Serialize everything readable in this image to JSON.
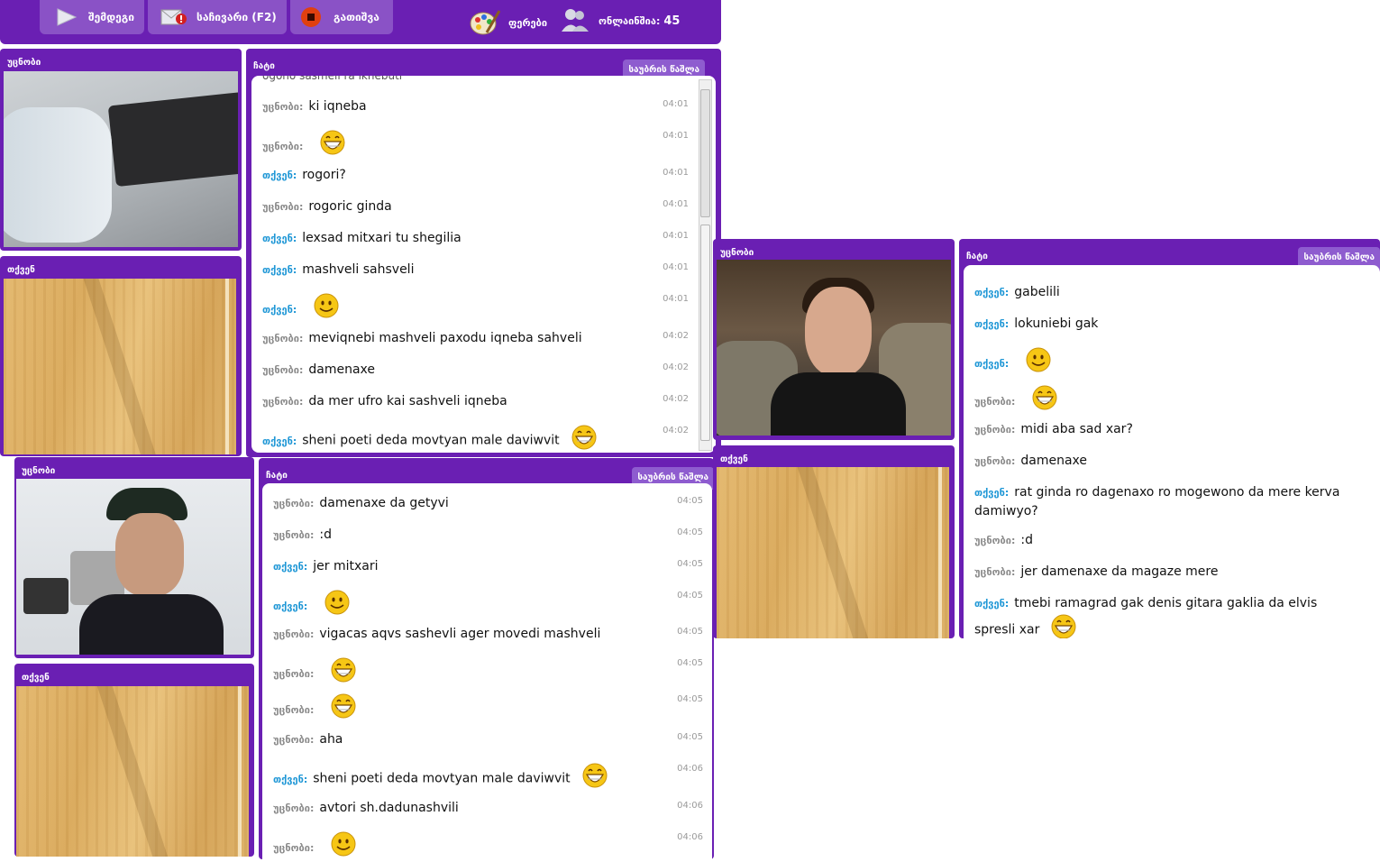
{
  "toolbar": {
    "next_label": "შემდეგი",
    "report_label": "საჩივარი (F2)",
    "stop_label": "გათიშვა",
    "colors_label": "ფერები",
    "online_label": "ონლაინშია:",
    "online_count": "45"
  },
  "labels": {
    "stranger": "უცნობი",
    "you": "თქვენ",
    "chat": "ჩატი",
    "history": "საუბრის წაშლა"
  },
  "chat1": {
    "top_partial": "ogono sasmeli ra iknebuti",
    "messages": [
      {
        "who": "უცნობი:",
        "text": "ki iqneba",
        "time": "04:01"
      },
      {
        "who": "უცნობი:",
        "text": "",
        "time": "04:01",
        "emoji": "grin"
      },
      {
        "who": "თქვენ:",
        "text": "rogori?",
        "time": "04:01"
      },
      {
        "who": "უცნობი:",
        "text": "rogoric ginda",
        "time": "04:01"
      },
      {
        "who": "თქვენ:",
        "text": "lexsad mitxari tu shegilia",
        "time": "04:01"
      },
      {
        "who": "თქვენ:",
        "text": "mashveli sahsveli",
        "time": "04:01"
      },
      {
        "who": "თქვენ:",
        "text": "",
        "time": "04:01",
        "emoji": "smile"
      },
      {
        "who": "უცნობი:",
        "text": "meviqnebi mashveli paxodu iqneba sahveli",
        "time": "04:02"
      },
      {
        "who": "უცნობი:",
        "text": "damenaxe",
        "time": "04:02"
      },
      {
        "who": "უცნობი:",
        "text": "da mer ufro kai sashveli iqneba",
        "time": "04:02"
      },
      {
        "who": "თქვენ:",
        "text": "sheni poeti deda movtyan male daviwvit",
        "time": "04:02",
        "emoji": "grin"
      }
    ]
  },
  "chat2": {
    "messages": [
      {
        "who": "უცნობი:",
        "text": "damenaxe da getyvi",
        "time": "04:05"
      },
      {
        "who": "უცნობი:",
        "text": ":d",
        "time": "04:05"
      },
      {
        "who": "თქვენ:",
        "text": "jer mitxari",
        "time": "04:05"
      },
      {
        "who": "თქვენ:",
        "text": "",
        "time": "04:05",
        "emoji": "smile"
      },
      {
        "who": "უცნობი:",
        "text": "vigacas aqvs sashevli ager movedi mashveli",
        "time": "04:05"
      },
      {
        "who": "უცნობი:",
        "text": "",
        "time": "04:05",
        "emoji": "grin"
      },
      {
        "who": "უცნობი:",
        "text": "",
        "time": "04:05",
        "emoji": "grin"
      },
      {
        "who": "უცნობი:",
        "text": "aha",
        "time": "04:05"
      },
      {
        "who": "თქვენ:",
        "text": "sheni poeti deda movtyan male daviwvit",
        "time": "04:06",
        "emoji": "grin"
      },
      {
        "who": "უცნობი:",
        "text": "avtori sh.dadunashvili",
        "time": "04:06"
      },
      {
        "who": "უცნობი:",
        "text": "",
        "time": "04:06",
        "emoji": "smile"
      }
    ]
  },
  "chat3": {
    "messages": [
      {
        "who": "თქვენ:",
        "text": "gabelili"
      },
      {
        "who": "თქვენ:",
        "text": "lokuniebi gak"
      },
      {
        "who": "თქვენ:",
        "text": "",
        "emoji": "smile"
      },
      {
        "who": "უცნობი:",
        "text": "",
        "emoji": "grin"
      },
      {
        "who": "უცნობი:",
        "text": "midi aba sad xar?"
      },
      {
        "who": "უცნობი:",
        "text": "damenaxe"
      },
      {
        "who": "თქვენ:",
        "text": "rat ginda ro dagenaxo ro mogewono da mere kerva damiwyo?"
      },
      {
        "who": "უცნობი:",
        "text": ":d"
      },
      {
        "who": "უცნობი:",
        "text": "jer damenaxe da magaze mere"
      },
      {
        "who": "თქვენ:",
        "text": "tmebi ramagrad gak denis gitara gaklia da elvis spresli xar",
        "emoji": "grin"
      }
    ]
  },
  "colors": {
    "purple": "#6a1fb3",
    "me": "#1f97d6",
    "stranger": "#8a8a8a"
  }
}
